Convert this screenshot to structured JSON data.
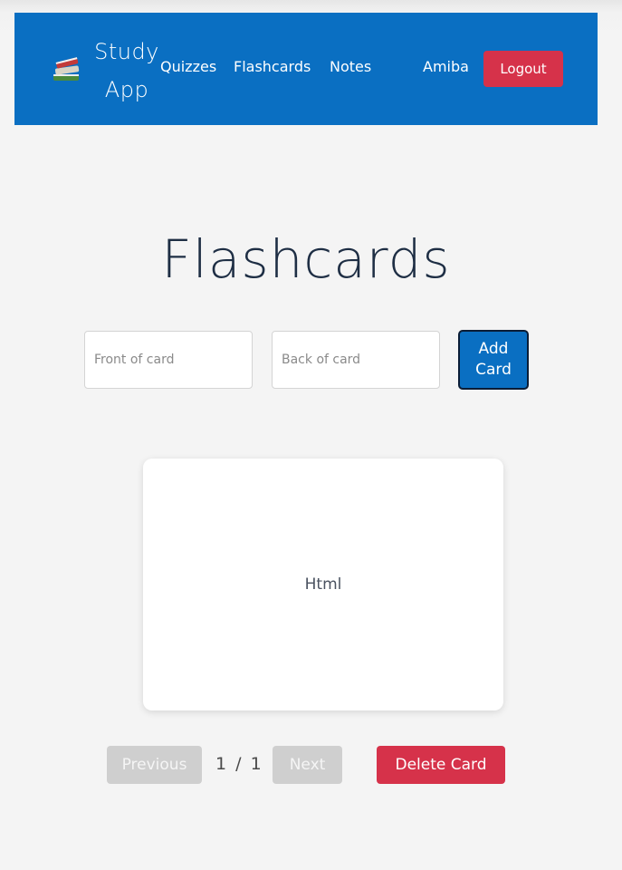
{
  "navbar": {
    "brand_line1": "Study",
    "brand_line2": "App",
    "links": [
      "Quizzes",
      "Flashcards",
      "Notes"
    ],
    "username": "Amiba",
    "logout_label": "Logout",
    "brand_icon": "books-icon"
  },
  "main": {
    "title": "Flashcards",
    "front_placeholder": "Front of card",
    "back_placeholder": "Back of card",
    "add_label": "Add Card",
    "card_text": "Html",
    "counter": "1 / 1",
    "previous_label": "Previous",
    "next_label": "Next",
    "delete_label": "Delete Card"
  },
  "colors": {
    "navbar": "#0a6fc2",
    "danger": "#d6324a",
    "disabled": "#cfcfcf",
    "title": "#1e2e44"
  }
}
